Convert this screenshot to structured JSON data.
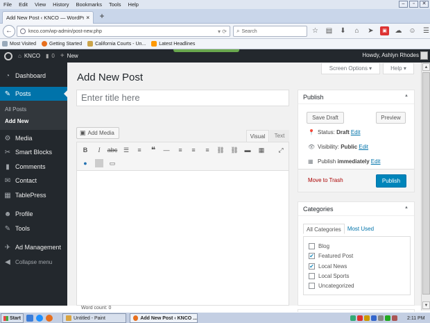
{
  "browser": {
    "menu": [
      "File",
      "Edit",
      "View",
      "History",
      "Bookmarks",
      "Tools",
      "Help"
    ],
    "window_buttons": [
      "–",
      "▫",
      "✕"
    ],
    "tab_title": "Add New Post ‹ KNCO — WordPress",
    "url": "knco.com/wp-admin/post-new.php",
    "search_placeholder": "Search",
    "bookmarks": [
      "Most Visited",
      "Getting Started",
      "California Courts - Un...",
      "Latest Headlines"
    ]
  },
  "adminbar": {
    "site_name": "KNCO",
    "comment_count": "0",
    "new_label": "New",
    "howdy": "Howdy, Ashlyn Rhodes"
  },
  "sidebar": {
    "items": [
      "Dashboard",
      "Posts",
      "Media",
      "Smart Blocks",
      "Comments",
      "Contact",
      "TablePress",
      "Profile",
      "Tools",
      "Ad Management",
      "Collapse menu"
    ],
    "posts_sub": [
      "All Posts",
      "Add New"
    ]
  },
  "header": {
    "screen_options": "Screen Options ▾",
    "help": "Help ▾",
    "page_title": "Add New Post"
  },
  "editor": {
    "title_placeholder": "Enter title here",
    "add_media": "Add Media",
    "tab_visual": "Visual",
    "tab_text": "Text",
    "word_count": "Word count: 0"
  },
  "publish": {
    "heading": "Publish",
    "save_draft": "Save Draft",
    "preview": "Preview",
    "status_label": "Status:",
    "status_value": "Draft",
    "visibility_label": "Visibility:",
    "visibility_value": "Public",
    "publish_label": "Publish",
    "publish_value": "immediately",
    "edit": "Edit",
    "move_to_trash": "Move to Trash",
    "publish_button": "Publish"
  },
  "categories": {
    "heading": "Categories",
    "tab_all": "All Categories",
    "tab_most_used": "Most Used",
    "items": [
      {
        "label": "Blog",
        "checked": false
      },
      {
        "label": "Featured Post",
        "checked": true
      },
      {
        "label": "Local News",
        "checked": true
      },
      {
        "label": "Local Sports",
        "checked": false
      },
      {
        "label": "Uncategorized",
        "checked": false
      }
    ]
  },
  "taskbar": {
    "start": "Start",
    "tasks": [
      "Untitled - Paint",
      "Add New Post ‹ KNCO ..."
    ],
    "clock": "2:11 PM"
  }
}
